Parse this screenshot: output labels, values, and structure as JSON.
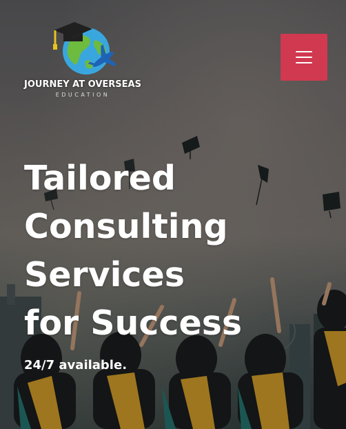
{
  "brand": {
    "name": "JOURNEY AT OVERSEAS",
    "subtitle": "EDUCATION"
  },
  "icons": {
    "logo": "globe-graduation-cap-airplane-icon",
    "menu": "hamburger-menu-icon"
  },
  "colors": {
    "menu_button": "#d0394f",
    "headline_text": "#ffffff"
  },
  "hero": {
    "headline_lines": [
      "Tailored",
      "Consulting",
      "Services",
      "for Success"
    ],
    "tagline": "24/7 available."
  }
}
